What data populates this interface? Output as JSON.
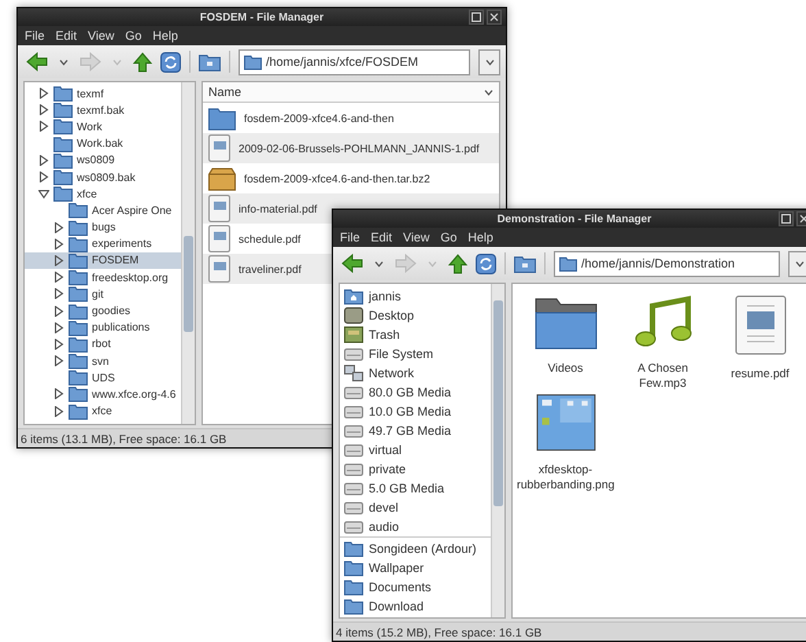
{
  "fosdem_window": {
    "title": "FOSDEM - File Manager",
    "menu": [
      "File",
      "Edit",
      "View",
      "Go",
      "Help"
    ],
    "path": "/home/jannis/xfce/FOSDEM",
    "tree": [
      {
        "label": "texmf",
        "kind": "collapsed",
        "selected": false
      },
      {
        "label": "texmf.bak",
        "kind": "collapsed",
        "selected": false
      },
      {
        "label": "Work",
        "kind": "collapsed",
        "selected": false
      },
      {
        "label": "Work.bak",
        "kind": "leaf",
        "selected": false
      },
      {
        "label": "ws0809",
        "kind": "collapsed",
        "selected": false
      },
      {
        "label": "ws0809.bak",
        "kind": "collapsed",
        "selected": false
      },
      {
        "label": "xfce",
        "kind": "expanded",
        "selected": false,
        "children": [
          {
            "label": "Acer Aspire One",
            "kind": "leaf",
            "selected": false
          },
          {
            "label": "bugs",
            "kind": "collapsed",
            "selected": false
          },
          {
            "label": "experiments",
            "kind": "collapsed",
            "selected": false
          },
          {
            "label": "FOSDEM",
            "kind": "collapsed",
            "selected": true
          },
          {
            "label": "freedesktop.org",
            "kind": "collapsed",
            "selected": false
          },
          {
            "label": "git",
            "kind": "collapsed",
            "selected": false
          },
          {
            "label": "goodies",
            "kind": "collapsed",
            "selected": false
          },
          {
            "label": "publications",
            "kind": "collapsed",
            "selected": false
          },
          {
            "label": "rbot",
            "kind": "collapsed",
            "selected": false
          },
          {
            "label": "svn",
            "kind": "collapsed",
            "selected": false
          },
          {
            "label": "UDS",
            "kind": "leaf",
            "selected": false
          },
          {
            "label": "www.xfce.org-4.6",
            "kind": "collapsed",
            "selected": false
          },
          {
            "label": "xfce",
            "kind": "collapsed",
            "selected": false
          }
        ]
      }
    ],
    "column": "Name",
    "files": [
      {
        "name": "fosdem-2009-xfce4.6-and-then",
        "kind": "folder"
      },
      {
        "name": "2009-02-06-Brussels-POHLMANN_JANNIS-1.pdf",
        "kind": "document"
      },
      {
        "name": "fosdem-2009-xfce4.6-and-then.tar.bz2",
        "kind": "archive"
      },
      {
        "name": "info-material.pdf",
        "kind": "document"
      },
      {
        "name": "schedule.pdf",
        "kind": "document"
      },
      {
        "name": "traveliner.pdf",
        "kind": "document"
      }
    ],
    "status": "6 items (13.1 MB), Free space: 16.1 GB"
  },
  "demonstration_window": {
    "title": "Demonstration - File Manager",
    "menu": [
      "File",
      "Edit",
      "View",
      "Go",
      "Help"
    ],
    "path": "/home/jannis/Demonstration",
    "devices": [
      {
        "label": "jannis",
        "kind": "home"
      },
      {
        "label": "Desktop",
        "kind": "desktop"
      },
      {
        "label": "Trash",
        "kind": "trash"
      },
      {
        "label": "File System",
        "kind": "drive"
      },
      {
        "label": "Network",
        "kind": "network"
      },
      {
        "label": "80.0 GB Media",
        "kind": "drive"
      },
      {
        "label": "10.0 GB Media",
        "kind": "drive"
      },
      {
        "label": "49.7 GB Media",
        "kind": "drive"
      },
      {
        "label": "virtual",
        "kind": "drive"
      },
      {
        "label": "private",
        "kind": "drive"
      },
      {
        "label": "5.0 GB Media",
        "kind": "drive"
      },
      {
        "label": "devel",
        "kind": "drive"
      },
      {
        "label": "audio",
        "kind": "drive"
      }
    ],
    "bookmarks": [
      {
        "label": "Songideen (Ardour)",
        "kind": "folder"
      },
      {
        "label": "Wallpaper",
        "kind": "folder"
      },
      {
        "label": "Documents",
        "kind": "folder"
      },
      {
        "label": "Download",
        "kind": "folder"
      }
    ],
    "items": [
      {
        "name": "Videos",
        "kind": "folder"
      },
      {
        "name": "A Chosen Few.mp3",
        "kind": "music"
      },
      {
        "name": "resume.pdf",
        "kind": "document"
      },
      {
        "name": "xfdesktop-rubberbanding.png",
        "kind": "image"
      }
    ],
    "status": "4 items (15.2 MB), Free space: 16.1 GB"
  }
}
